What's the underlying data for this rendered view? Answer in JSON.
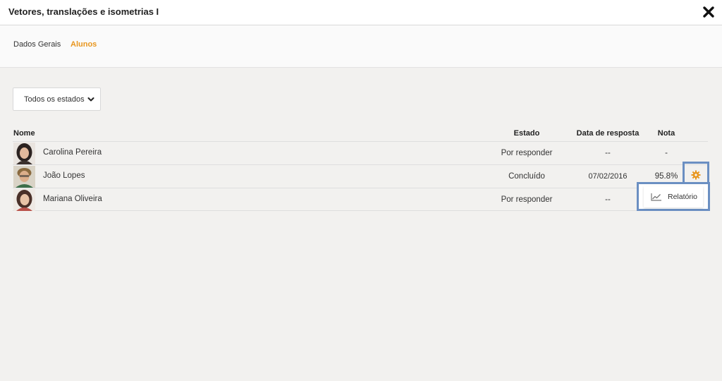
{
  "window": {
    "title": "Vetores, translações e isometrias I"
  },
  "tabs": [
    {
      "label": "Dados Gerais",
      "active": false
    },
    {
      "label": "Alunos",
      "active": true
    }
  ],
  "filter": {
    "selected": "Todos os estados"
  },
  "table": {
    "headers": {
      "name": "Nome",
      "state": "Estado",
      "date": "Data de resposta",
      "grade": "Nota"
    },
    "rows": [
      {
        "name": "Carolina Pereira",
        "state": "Por responder",
        "date": "--",
        "grade": "-"
      },
      {
        "name": "João Lopes",
        "state": "Concluído",
        "date": "07/02/2016",
        "grade": "95.8%"
      },
      {
        "name": "Mariana Oliveira",
        "state": "Por responder",
        "date": "--",
        "grade": ""
      }
    ]
  },
  "context_menu": {
    "items": [
      {
        "label": "Relatório",
        "icon": "chart-line-icon"
      }
    ]
  },
  "colors": {
    "accent": "#e8961e",
    "highlight": "#6b8fc2",
    "background": "#f2f1ef"
  }
}
